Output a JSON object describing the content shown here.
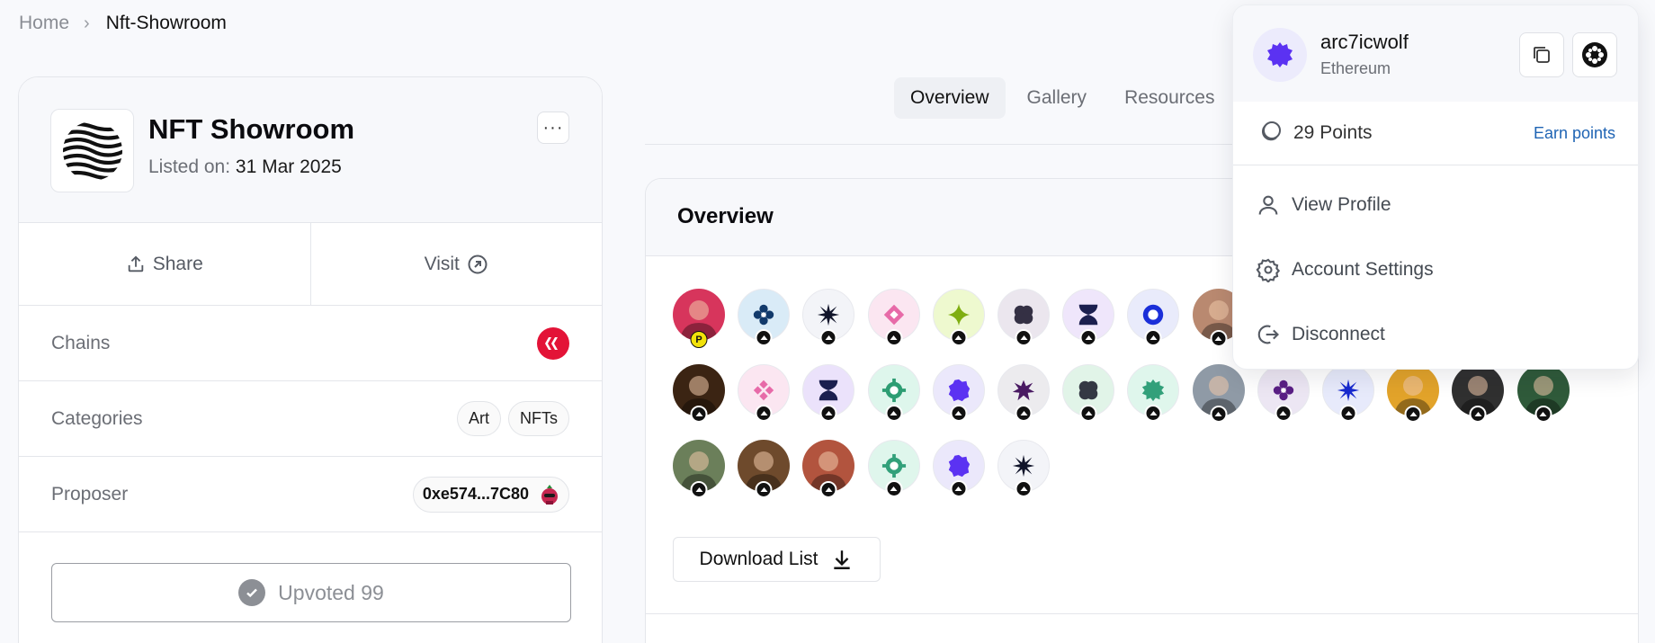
{
  "breadcrumb": {
    "home": "Home",
    "current": "Nft-Showroom"
  },
  "project": {
    "name": "NFT Showroom",
    "listed_label": "Listed on:",
    "listed_date": "31 Mar 2025",
    "more_label": "···",
    "share_label": "Share",
    "visit_label": "Visit",
    "chains_label": "Chains",
    "categories_label": "Categories",
    "categories": [
      "Art",
      "NFTs"
    ],
    "proposer_label": "Proposer",
    "proposer_address": "0xe574...7C80",
    "upvote_label": "Upvoted 99"
  },
  "tabs": [
    "Overview",
    "Gallery",
    "Resources"
  ],
  "overview": {
    "title": "Overview",
    "download_label": "Download List",
    "voters": [
      {
        "kind": "photo",
        "bg": "#d7355c",
        "badge": "P"
      },
      {
        "kind": "icon",
        "bg": "#d9ebf7",
        "fg": "#123a6b",
        "shape": "flower"
      },
      {
        "kind": "icon",
        "bg": "#f3f4f8",
        "fg": "#10142a",
        "shape": "burst"
      },
      {
        "kind": "icon",
        "bg": "#fbe6f1",
        "fg": "#e76aa8",
        "shape": "diamond"
      },
      {
        "kind": "icon",
        "bg": "#eef9cf",
        "fg": "#7fae11",
        "shape": "star4"
      },
      {
        "kind": "icon",
        "bg": "#ebe6ee",
        "fg": "#343044",
        "shape": "clover"
      },
      {
        "kind": "icon",
        "bg": "#efe6fb",
        "fg": "#1b1f4f",
        "shape": "hourglass"
      },
      {
        "kind": "icon",
        "bg": "#e9ebfb",
        "fg": "#1b2fd9",
        "shape": "ring"
      },
      {
        "kind": "photo",
        "bg": "#b98970"
      },
      {
        "kind": "photo",
        "bg": "#3b2413"
      },
      {
        "kind": "icon",
        "bg": "#fbe6f1",
        "fg": "#e76aa8",
        "shape": "diamonds"
      },
      {
        "kind": "icon",
        "bg": "#ebe2fb",
        "fg": "#1b1f4f",
        "shape": "hourglass"
      },
      {
        "kind": "icon",
        "bg": "#def6ec",
        "fg": "#2d9d73",
        "shape": "gear"
      },
      {
        "kind": "icon",
        "bg": "#ebe8fb",
        "fg": "#5b32f2",
        "shape": "blob"
      },
      {
        "kind": "icon",
        "bg": "#ecebee",
        "fg": "#4a1a63",
        "shape": "spiky"
      },
      {
        "kind": "icon",
        "bg": "#e1f4e8",
        "fg": "#343844",
        "shape": "clover"
      },
      {
        "kind": "icon",
        "bg": "#dff6ec",
        "fg": "#32a07a",
        "shape": "cog"
      },
      {
        "kind": "photo",
        "bg": "#8f9aa6"
      },
      {
        "kind": "icon",
        "bg": "#ece6f3",
        "fg": "#5a1f85",
        "shape": "flower"
      },
      {
        "kind": "icon",
        "bg": "#e7eafb",
        "fg": "#1729cf",
        "shape": "burst"
      },
      {
        "kind": "photo",
        "bg": "#e2a32a"
      },
      {
        "kind": "photo",
        "bg": "#303030"
      },
      {
        "kind": "photo",
        "bg": "#2f5a3a"
      },
      {
        "kind": "photo",
        "bg": "#6b7f5a"
      },
      {
        "kind": "photo",
        "bg": "#6e4a2c"
      },
      {
        "kind": "photo",
        "bg": "#b2543e"
      },
      {
        "kind": "icon",
        "bg": "#dff6ec",
        "fg": "#32a07a",
        "shape": "gear"
      },
      {
        "kind": "icon",
        "bg": "#ebe8fb",
        "fg": "#5b32f2",
        "shape": "blob"
      },
      {
        "kind": "icon",
        "bg": "#f3f4f8",
        "fg": "#10142a",
        "shape": "burst"
      }
    ]
  },
  "account": {
    "username": "arc7icwolf",
    "chain": "Ethereum",
    "points": "29 Points",
    "earn_label": "Earn points",
    "menu": [
      {
        "label": "View Profile",
        "icon": "user-icon"
      },
      {
        "label": "Account Settings",
        "icon": "gear-icon"
      },
      {
        "label": "Disconnect",
        "icon": "logout-icon"
      }
    ]
  },
  "colors": {
    "hive_red": "#e31337",
    "accent_purple": "#5b32f2",
    "link_blue": "#1f64b4"
  }
}
